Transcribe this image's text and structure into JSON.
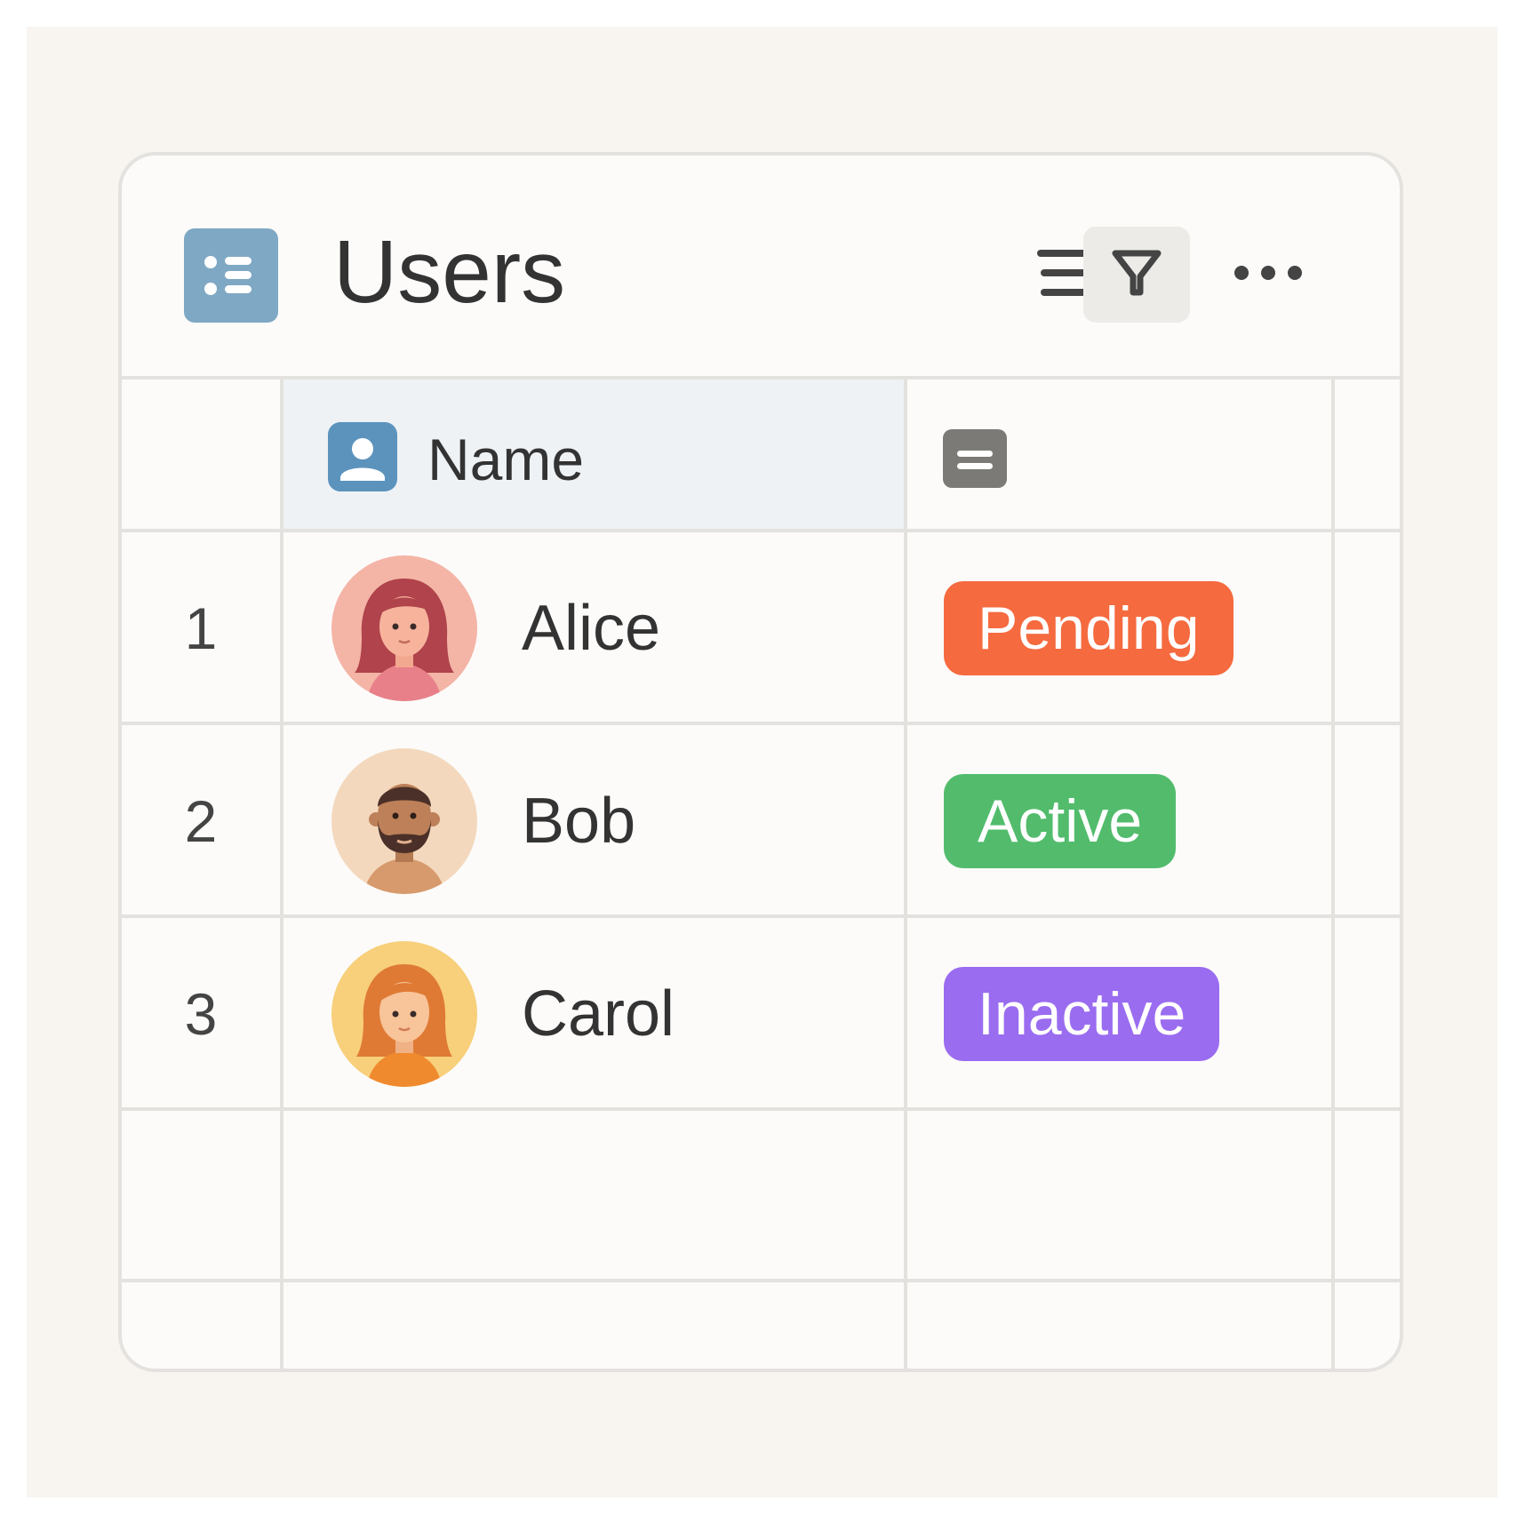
{
  "database": {
    "title": "Users",
    "icon": "list-icon",
    "icon_color": "#7fa8c4"
  },
  "toolbar": {
    "sort_icon": "sort-lines-icon",
    "filter_icon": "filter-icon",
    "more_icon": "more-dots-icon"
  },
  "columns": [
    {
      "label": "",
      "kind": "row-number"
    },
    {
      "label": "Name",
      "icon": "person-icon",
      "icon_color": "#5b93bd"
    },
    {
      "label": "",
      "icon": "text-icon",
      "icon_color": "#7b7a77"
    }
  ],
  "rows": [
    {
      "num": "1",
      "name": "Alice",
      "avatar": "woman-red-hair-avatar",
      "status": "Pending",
      "status_color": "#f56a3f"
    },
    {
      "num": "2",
      "name": "Bob",
      "avatar": "man-beard-avatar",
      "status": "Active",
      "status_color": "#52bc6c"
    },
    {
      "num": "3",
      "name": "Carol",
      "avatar": "woman-orange-hair-avatar",
      "status": "Inactive",
      "status_color": "#9a6cf0"
    }
  ]
}
